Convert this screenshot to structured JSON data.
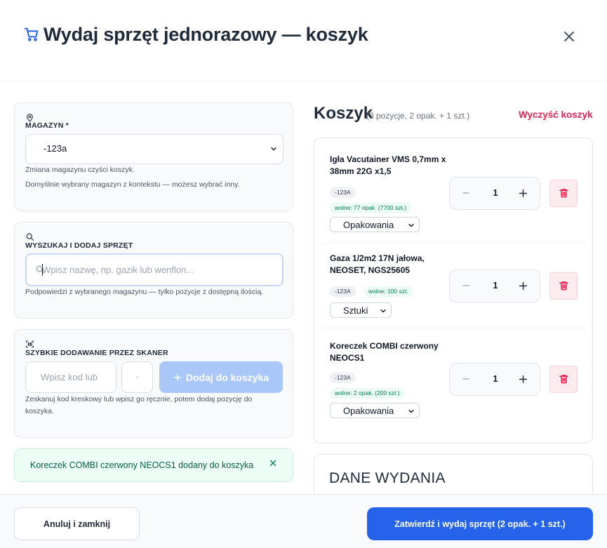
{
  "header": {
    "title": "Wydaj sprzęt jednorazowy — koszyk",
    "icon": "shopping-cart-icon",
    "close_icon": "close-icon"
  },
  "warehouse": {
    "label": "MAGAZYN *",
    "selected": "-123a",
    "hint1": "Zmiana magazynu czyści koszyk.",
    "hint2": "Domyślnie wybrany magazyn z kontekstu — możesz wybrać inny."
  },
  "search": {
    "label": "WYSZUKAJ I DODAJ SPRZĘT",
    "placeholder": "Wpisz nazwę, np. gazik lub wenflon...",
    "hint": "Podpowiedzi z wybranego magazynu — tylko pozycje z dostępną ilością."
  },
  "scanner": {
    "label": "SZYBKIE DODAWANIE PRZEZ SKANER",
    "code_placeholder": "Wpisz kod lub",
    "qty_placeholder": "·",
    "add_button": "Dodaj do koszyka",
    "hint": "Zeskanuj kod kreskowy lub wpisz go ręcznie, potem dodaj pozycję do koszyka."
  },
  "toast": {
    "message": "Koreczek COMBI czerwony NEOCS1 dodany do koszyka"
  },
  "cart": {
    "title": "Koszyk",
    "summary": "(3 pozycje, 2 opak. + 1 szt.)",
    "clear_label": "Wyczyść koszyk",
    "items": [
      {
        "name": "Igła Vacutainer VMS 0,7mm x 38mm 22G x1,5",
        "warehouse": "-123A",
        "availability": "wolne: 77 opak. (7700 szt.)",
        "unit": "Opakowania",
        "qty": "1"
      },
      {
        "name": "Gaza 1/2m2 17N jałowa, NEOSET, NGS25605",
        "warehouse": "-123A",
        "availability": "wolne: 100 szt.",
        "unit": "Sztuki",
        "qty": "1"
      },
      {
        "name": "Koreczek COMBI czerwony NEOCS1",
        "warehouse": "-123A",
        "availability": "wolne: 2 opak. (200 szt.)",
        "unit": "Opakowania",
        "qty": "1"
      }
    ]
  },
  "dane": {
    "title": "DANE WYDANIA"
  },
  "footer": {
    "cancel": "Anuluj i zamknij",
    "confirm": "Zatwierdź i wydaj sprzęt  (2 opak. + 1 szt.)"
  },
  "colors": {
    "primary": "#2563eb",
    "primary_disabled": "#a9c7f8",
    "danger": "#dc2654",
    "success_bg": "#ecfdf5",
    "success_text": "#065f46"
  }
}
